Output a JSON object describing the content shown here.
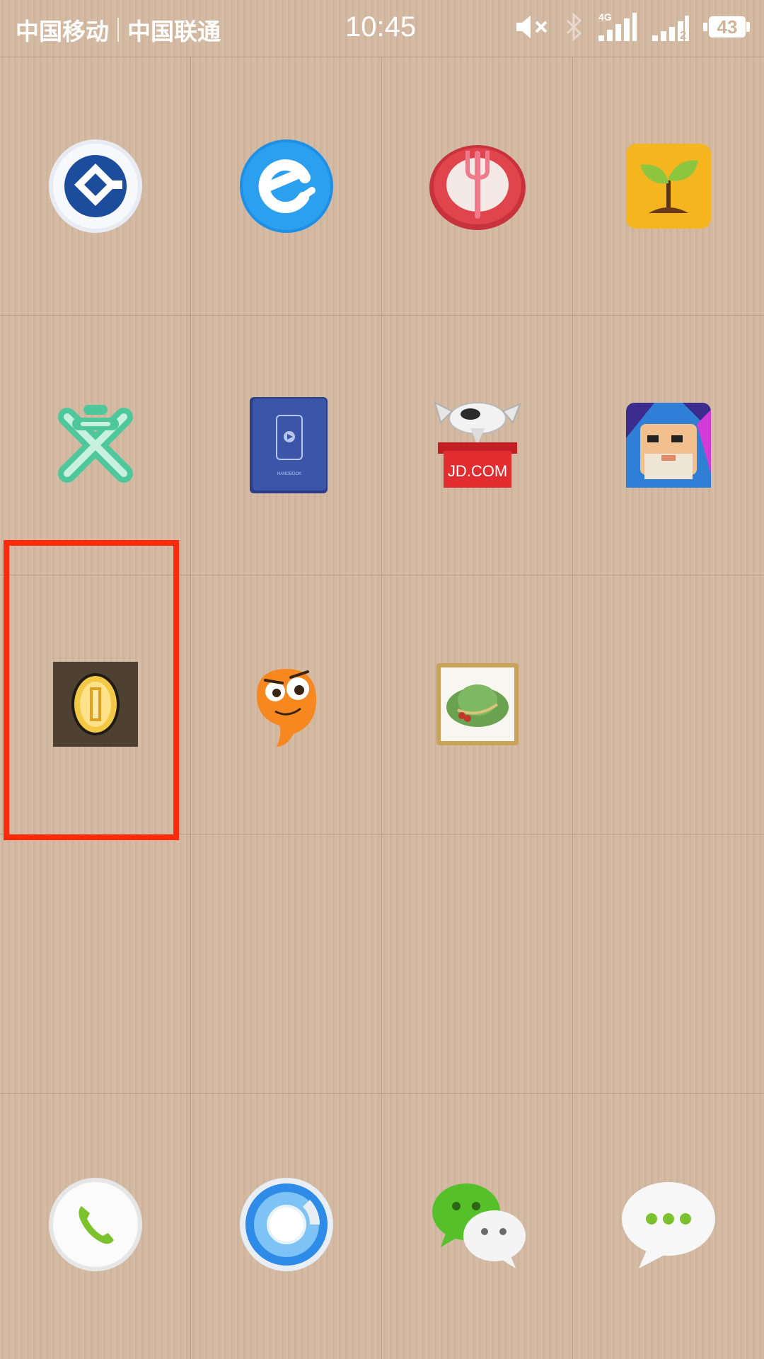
{
  "status_bar": {
    "carrier_1": "中国移动",
    "carrier_2": "中国联通",
    "time": "10:45",
    "network_type": "4G",
    "sim2_label": "2",
    "battery_level": "43",
    "icons": [
      "mute-icon",
      "bluetooth-icon",
      "signal-4g-icon",
      "signal-sim2-icon",
      "battery-icon"
    ]
  },
  "home": {
    "rows": [
      [
        "bank-app-icon",
        "e-browser-app-icon",
        "food-app-icon",
        "sprout-app-icon"
      ],
      [
        "x-star-app-icon",
        "handbook-app-icon",
        "jd-app-icon",
        "warrior-game-app-icon"
      ],
      [
        "coin-app-icon",
        "orange-bird-app-icon",
        "hat-frame-app-icon"
      ]
    ]
  },
  "app_labels": {
    "jd_box_text": "JD.COM",
    "handbook_text": "HANDBOOK"
  },
  "dock": [
    "phone-icon",
    "browser-icon",
    "wechat-icon",
    "messages-icon"
  ],
  "highlight": {
    "target": "coin-app-icon",
    "color": "#ff2a0c"
  }
}
